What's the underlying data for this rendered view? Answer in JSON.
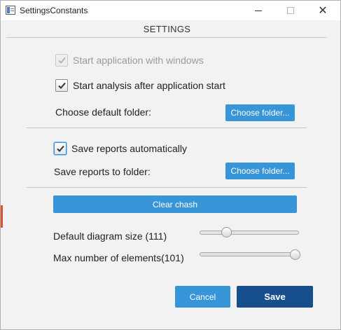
{
  "window": {
    "title": "SettingsConstants",
    "minimize_glyph": "",
    "maximize_glyph": "",
    "close_glyph": "✕",
    "icon": "app-window-icon"
  },
  "heading": "SETTINGS",
  "options": {
    "start_with_windows": {
      "label": "Start application with windows",
      "checked": true,
      "disabled": true
    },
    "start_analysis": {
      "label": "Start analysis after application start",
      "checked": true,
      "disabled": false
    },
    "save_reports": {
      "label": "Save reports automatically",
      "checked": true,
      "focused": true
    }
  },
  "default_folder": {
    "label": "Choose default folder:",
    "button": "Choose folder..."
  },
  "report_folder": {
    "label": "Save reports to folder:",
    "button": "Choose folder..."
  },
  "clear_button": "Clear chash",
  "sliders": {
    "diagram_size": {
      "label": "Default diagram size (111)",
      "value": 111,
      "position_fraction": 0.25
    },
    "max_elements": {
      "label": "Max number of elements(101)",
      "value": 101,
      "position_fraction": 1.0
    }
  },
  "actions": {
    "cancel": "Cancel",
    "save": "Save"
  },
  "colors": {
    "accent": "#3895d8",
    "primary": "#174e8c"
  }
}
